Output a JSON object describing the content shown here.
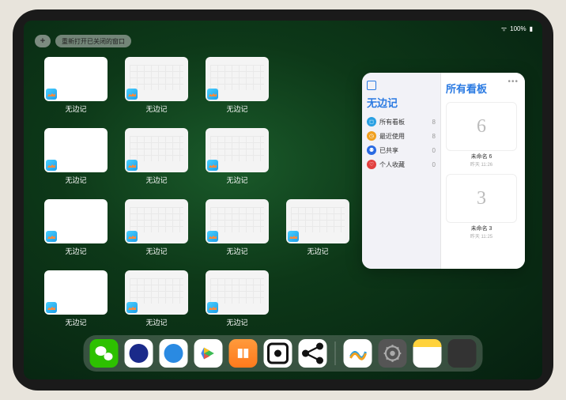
{
  "status": {
    "battery": "100%",
    "wifi": "wifi-icon",
    "time": ""
  },
  "topbar": {
    "plus": "+",
    "reopen_label": "重新打开已关闭的窗口"
  },
  "app_label": "无边记",
  "thumbs": [
    {
      "style": "blank"
    },
    {
      "style": "calendar"
    },
    {
      "style": "calendar"
    },
    null,
    {
      "style": "blank"
    },
    {
      "style": "calendar"
    },
    {
      "style": "calendar"
    },
    null,
    {
      "style": "blank"
    },
    {
      "style": "calendar"
    },
    {
      "style": "calendar"
    },
    {
      "style": "calendar"
    },
    {
      "style": "blank"
    },
    {
      "style": "calendar"
    },
    {
      "style": "calendar"
    },
    null
  ],
  "panel": {
    "left_title": "无边记",
    "right_title": "所有看板",
    "categories": [
      {
        "label": "所有看板",
        "count": "8",
        "color": "#2aa0e2",
        "glyph": "◻"
      },
      {
        "label": "最近使用",
        "count": "8",
        "color": "#f0a020",
        "glyph": "◷"
      },
      {
        "label": "已共享",
        "count": "0",
        "color": "#2a6ae2",
        "glyph": "⚉"
      },
      {
        "label": "个人收藏",
        "count": "0",
        "color": "#e24040",
        "glyph": "♡"
      }
    ],
    "boards": [
      {
        "name": "未命名 6",
        "sub": "昨天 11:26",
        "glyph": "6"
      },
      {
        "name": "未命名 3",
        "sub": "昨天 11:25",
        "glyph": "3"
      }
    ]
  },
  "dock": {
    "items": [
      {
        "name": "wechat"
      },
      {
        "name": "browser-1"
      },
      {
        "name": "browser-2"
      },
      {
        "name": "play"
      },
      {
        "name": "books"
      },
      {
        "name": "dice"
      },
      {
        "name": "node"
      }
    ],
    "recent": [
      {
        "name": "freeform"
      },
      {
        "name": "settings"
      },
      {
        "name": "notes"
      },
      {
        "name": "launchpad"
      }
    ]
  }
}
